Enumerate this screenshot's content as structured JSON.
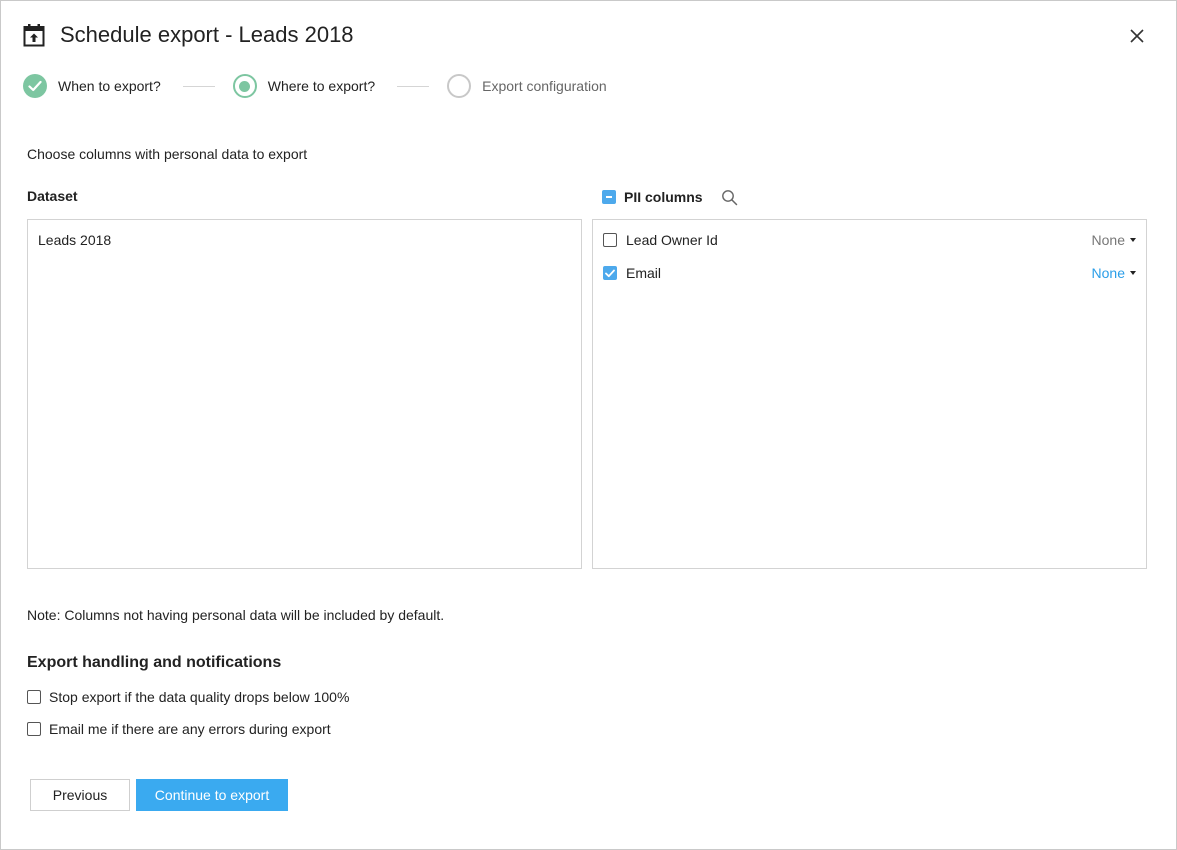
{
  "dialog": {
    "title": "Schedule export - Leads 2018"
  },
  "stepper": {
    "steps": [
      {
        "label": "When to export?",
        "state": "done"
      },
      {
        "label": "Where to export?",
        "state": "current"
      },
      {
        "label": "Export configuration",
        "state": "pending"
      }
    ]
  },
  "intro_text": "Choose columns with personal data to export",
  "dataset": {
    "label": "Dataset",
    "items": [
      "Leads 2018"
    ]
  },
  "pii": {
    "label": "PII columns",
    "master_state": "indeterminate",
    "columns": [
      {
        "name": "Lead Owner Id",
        "checked": false,
        "option": "None"
      },
      {
        "name": "Email",
        "checked": true,
        "option": "None"
      }
    ]
  },
  "note": "Note: Columns not having personal data will be included by default.",
  "handling": {
    "title": "Export handling and notifications",
    "options": [
      {
        "label": "Stop export if the data quality drops below 100%",
        "checked": false
      },
      {
        "label": "Email me if there are any errors during export",
        "checked": false
      }
    ]
  },
  "buttons": {
    "previous": "Previous",
    "continue": "Continue to export"
  },
  "colors": {
    "accent": "#3aaaf0",
    "success": "#7dc6a1",
    "link": "#2b9ee8"
  },
  "icons": {
    "header": "calendar-export-icon",
    "close": "close-icon",
    "search": "search-icon",
    "step_done": "check-icon"
  }
}
